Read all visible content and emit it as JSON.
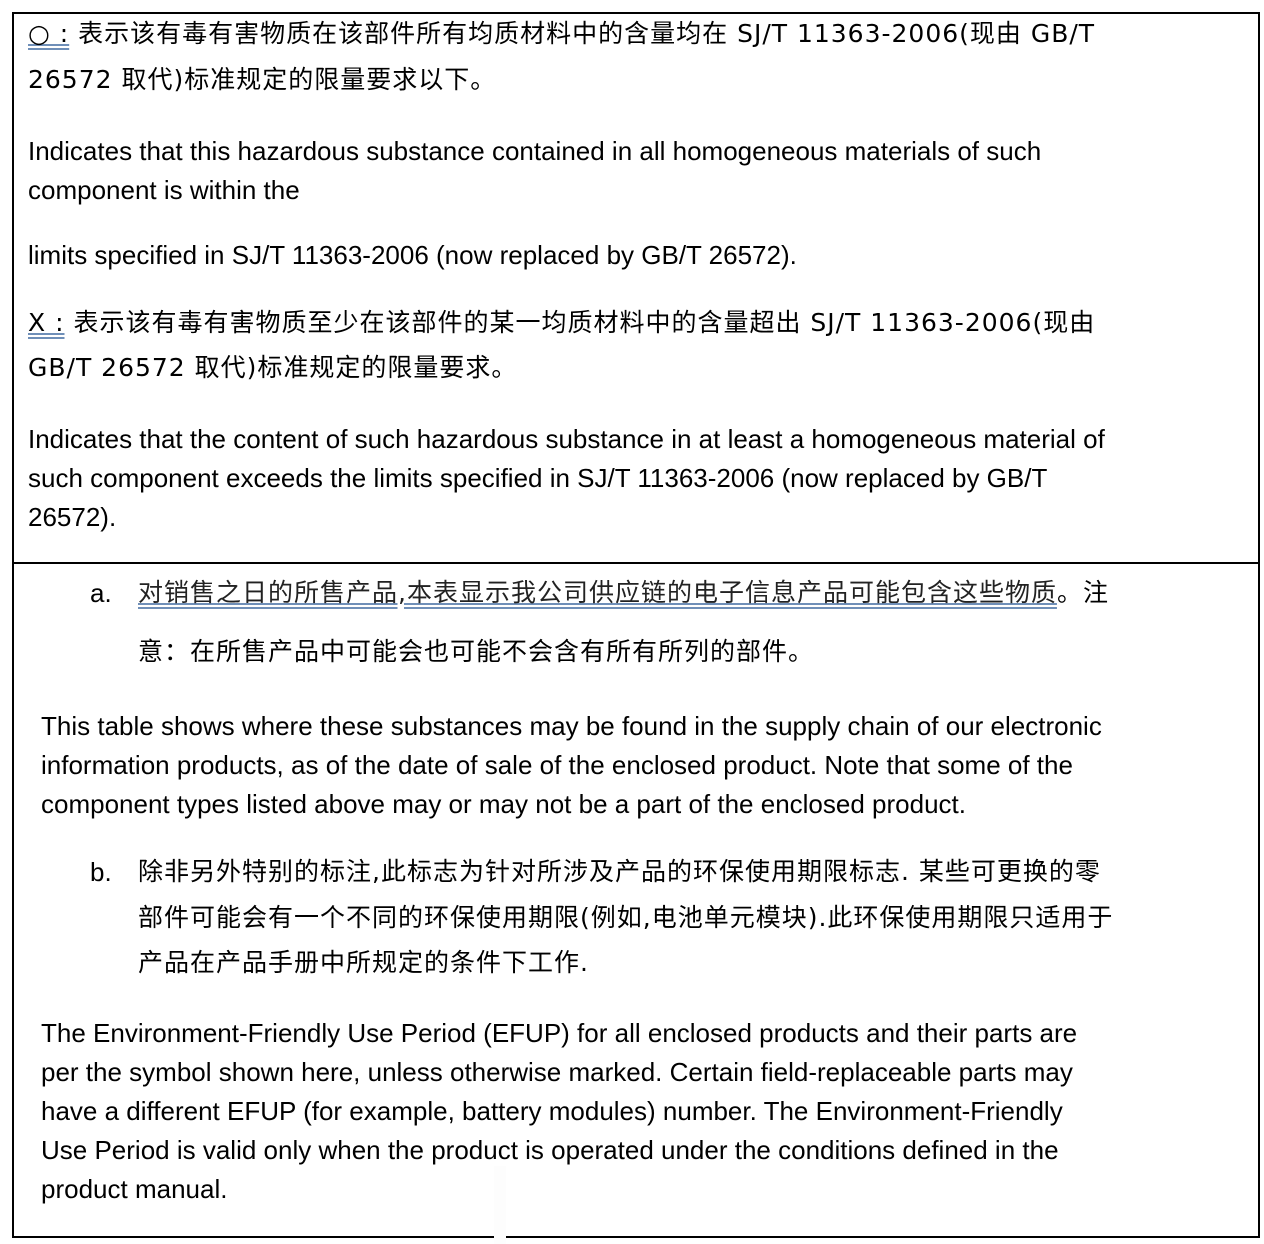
{
  "top_box": {
    "circle_symbol": "○ :",
    "circle_cn_line1": " 表示该有毒有害物质在该部件所有均质材料中的含量均在 SJ/T 11363-2006(现由 GB/T",
    "circle_cn_line2": "26572 取代)标准规定的限量要求以下。",
    "circle_en_line1": "Indicates that this hazardous substance contained in all homogeneous materials of such",
    "circle_en_line2": "component is within the",
    "circle_en_line3": "limits specified in SJ/T 11363-2006 (now replaced by GB/T 26572).",
    "x_symbol": "X :",
    "x_cn_line1": "  表示该有毒有害物质至少在该部件的某一均质材料中的含量超出 SJ/T 11363-2006(现由",
    "x_cn_line2": "GB/T 26572 取代)标准规定的限量要求。",
    "x_en_line1": "Indicates that the content of such hazardous substance in at least a homogeneous material of",
    "x_en_line2": "such component exceeds the limits specified in SJ/T 11363-2006 (now replaced by GB/T",
    "x_en_line3": "26572)."
  },
  "bottom_box": {
    "item_a_marker": "a.",
    "item_a_cn_line1_underlined": "对销售之日的所售产品,本表显示我公司供应链的电子信息产品可能包含这些物质",
    "item_a_cn_line1_rest": "。注",
    "item_a_cn_line2": "意：在所售产品中可能会也可能不会含有所有所列的部件。",
    "item_a_en_line1": "This table shows where these substances may be found in the supply chain of our electronic",
    "item_a_en_line2": "information products, as of the date of sale of the enclosed product.  Note that some of the",
    "item_a_en_line3": "component types listed above may or may not be a part of the enclosed product.",
    "item_b_marker": "b.",
    "item_b_cn_line1": "除非另外特别的标注,此标志为针对所涉及产品的环保使用期限标志. 某些可更换的零",
    "item_b_cn_line2": "部件可能会有一个不同的环保使用期限(例如,电池单元模块).此环保使用期限只适用于",
    "item_b_cn_line3": "产品在产品手册中所规定的条件下工作.",
    "item_b_en_line1": "The Environment-Friendly Use Period (EFUP) for all enclosed products and their parts are",
    "item_b_en_line2": "per the symbol shown here, unless otherwise marked.  Certain field-replaceable parts may",
    "item_b_en_line3": "have a different EFUP (for example, battery modules) number.  The Environment-Friendly",
    "item_b_en_line4": "Use Period is valid only when the product is operated under the conditions defined in the",
    "item_b_en_line5": "product manual."
  }
}
